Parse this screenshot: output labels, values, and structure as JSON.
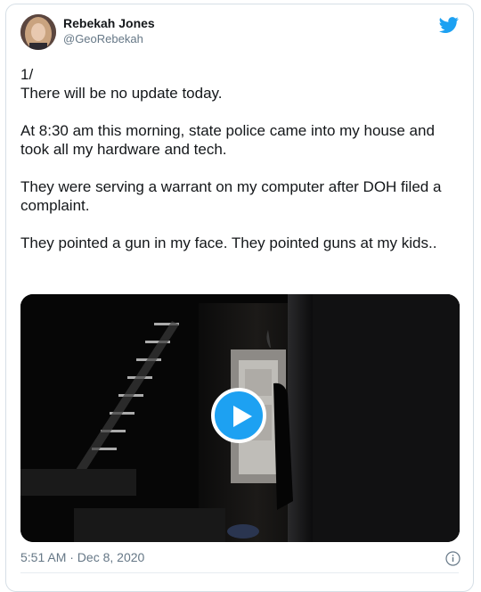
{
  "author": {
    "name": "Rebekah Jones",
    "handle": "@GeoRebekah"
  },
  "tweet": {
    "paragraphs": [
      "1/\nThere will be no update today.",
      "At 8:30 am this morning, state police came into my house and took all my hardware and tech.",
      "They were serving a warrant on my computer after DOH filed a complaint.",
      "They pointed a gun in my face.  They pointed guns at my kids.."
    ],
    "timestamp": "5:51 AM · Dec 8, 2020"
  },
  "icons": {
    "brand": "twitter-bird-icon",
    "play": "play-icon",
    "info": "info-icon"
  },
  "colors": {
    "accent": "#1da1f2",
    "text": "#14171a",
    "secondary": "#657786",
    "border": "#d6dfe6"
  }
}
